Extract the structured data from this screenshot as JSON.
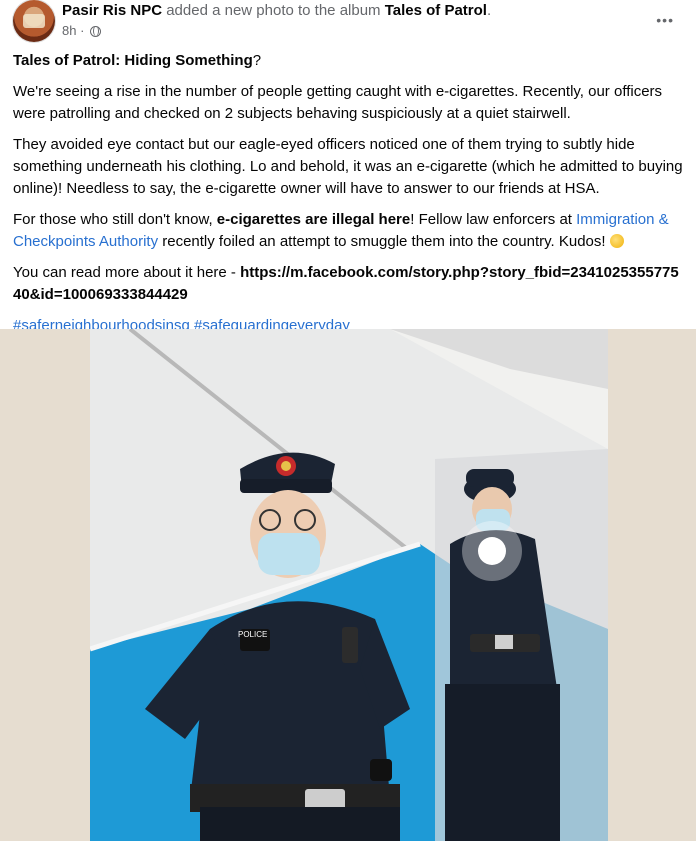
{
  "post": {
    "page_name": "Pasir Ris NPC",
    "action_text": " added a new photo to the album ",
    "album_name": "Tales of Patrol",
    "album_suffix": ".",
    "time": "8h ·",
    "more_label": "•••",
    "title_part1": "Tales of Patrol",
    "title_colon": ": ",
    "title_part2": "Hiding Something",
    "title_qmark": "?",
    "paragraph1": "We're seeing a rise in the number of people getting caught with e-cigarettes. Recently, our officers were patrolling and checked on 2 subjects behaving suspiciously at a quiet stairwell.",
    "paragraph2": "They avoided eye contact but our eagle-eyed officers noticed one of them trying to subtly hide something underneath his clothing. Lo and behold, it was an e-cigarette (which he admitted to buying online)! Needless to say, the e-cigarette owner will have to answer to our friends at HSA.",
    "p3_a": "For those who still don't know, ",
    "p3_bold": "e-cigarettes are illegal here",
    "p3_b": "! Fellow law enforcers at ",
    "p3_link": "Immigration & Checkpoints Authority",
    "p3_c": " recently foiled an attempt to smuggle them into the country. Kudos! ",
    "p4_a": "You can read more about it here - ",
    "p4_link": "https://m.facebook.com/story.php?story_fbid=234102535577540&id=100069333844429",
    "hashtag1": "#saferneighbourhoodsinsg",
    "hashtag2": "#safeguardingeveryday",
    "badge_text": "POLICE",
    "colors": {
      "link": "#2870d0",
      "meta": "#65676b",
      "wall_blue": "#1e9ad6",
      "uniform": "#1b2433"
    }
  }
}
